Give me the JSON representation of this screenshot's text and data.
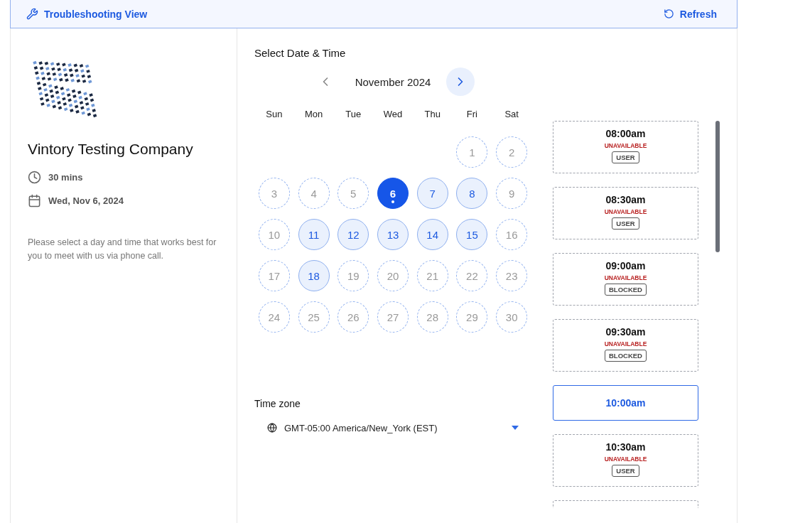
{
  "top_bar": {
    "title": "Troubleshooting View",
    "refresh": "Refresh"
  },
  "company": {
    "name": "Vintory Testing Company",
    "duration": "30 mins",
    "date": "Wed, Nov 6, 2024",
    "description": "Please select a day and time that works best for you to meet with us via phone call."
  },
  "calendar": {
    "heading": "Select Date & Time",
    "month": "November 2024",
    "weekdays": [
      "Sun",
      "Mon",
      "Tue",
      "Wed",
      "Thu",
      "Fri",
      "Sat"
    ],
    "days": [
      {
        "kind": "blank"
      },
      {
        "kind": "blank"
      },
      {
        "kind": "blank"
      },
      {
        "kind": "blank"
      },
      {
        "kind": "blank"
      },
      {
        "label": "1",
        "kind": "unavailable",
        "selected": false
      },
      {
        "label": "2",
        "kind": "unavailable",
        "selected": false
      },
      {
        "label": "3",
        "kind": "unavailable",
        "selected": false
      },
      {
        "label": "4",
        "kind": "unavailable",
        "selected": false
      },
      {
        "label": "5",
        "kind": "unavailable",
        "selected": false
      },
      {
        "label": "6",
        "kind": "available",
        "selected": true
      },
      {
        "label": "7",
        "kind": "available",
        "selected": false
      },
      {
        "label": "8",
        "kind": "available",
        "selected": false
      },
      {
        "label": "9",
        "kind": "unavailable",
        "selected": false
      },
      {
        "label": "10",
        "kind": "unavailable",
        "selected": false
      },
      {
        "label": "11",
        "kind": "available",
        "selected": false
      },
      {
        "label": "12",
        "kind": "available",
        "selected": false
      },
      {
        "label": "13",
        "kind": "available",
        "selected": false
      },
      {
        "label": "14",
        "kind": "available",
        "selected": false
      },
      {
        "label": "15",
        "kind": "available",
        "selected": false
      },
      {
        "label": "16",
        "kind": "unavailable",
        "selected": false
      },
      {
        "label": "17",
        "kind": "unavailable",
        "selected": false
      },
      {
        "label": "18",
        "kind": "available",
        "selected": false
      },
      {
        "label": "19",
        "kind": "unavailable",
        "selected": false
      },
      {
        "label": "20",
        "kind": "unavailable",
        "selected": false
      },
      {
        "label": "21",
        "kind": "unavailable",
        "selected": false
      },
      {
        "label": "22",
        "kind": "unavailable",
        "selected": false
      },
      {
        "label": "23",
        "kind": "unavailable",
        "selected": false
      },
      {
        "label": "24",
        "kind": "unavailable",
        "selected": false
      },
      {
        "label": "25",
        "kind": "unavailable",
        "selected": false
      },
      {
        "label": "26",
        "kind": "unavailable",
        "selected": false
      },
      {
        "label": "27",
        "kind": "unavailable",
        "selected": false
      },
      {
        "label": "28",
        "kind": "unavailable",
        "selected": false
      },
      {
        "label": "29",
        "kind": "unavailable",
        "selected": false
      },
      {
        "label": "30",
        "kind": "unavailable",
        "selected": false
      }
    ]
  },
  "timezone": {
    "label": "Time zone",
    "value": "GMT-05:00 America/New_York (EST)"
  },
  "slots": [
    {
      "kind": "unavailable",
      "time": "08:00am",
      "status": "UNAVAILABLE",
      "reason": "USER"
    },
    {
      "kind": "unavailable",
      "time": "08:30am",
      "status": "UNAVAILABLE",
      "reason": "USER"
    },
    {
      "kind": "unavailable",
      "time": "09:00am",
      "status": "UNAVAILABLE",
      "reason": "BLOCKED"
    },
    {
      "kind": "unavailable",
      "time": "09:30am",
      "status": "UNAVAILABLE",
      "reason": "BLOCKED"
    },
    {
      "kind": "available",
      "time": "10:00am"
    },
    {
      "kind": "unavailable",
      "time": "10:30am",
      "status": "UNAVAILABLE",
      "reason": "USER"
    },
    {
      "kind": "partial"
    }
  ]
}
